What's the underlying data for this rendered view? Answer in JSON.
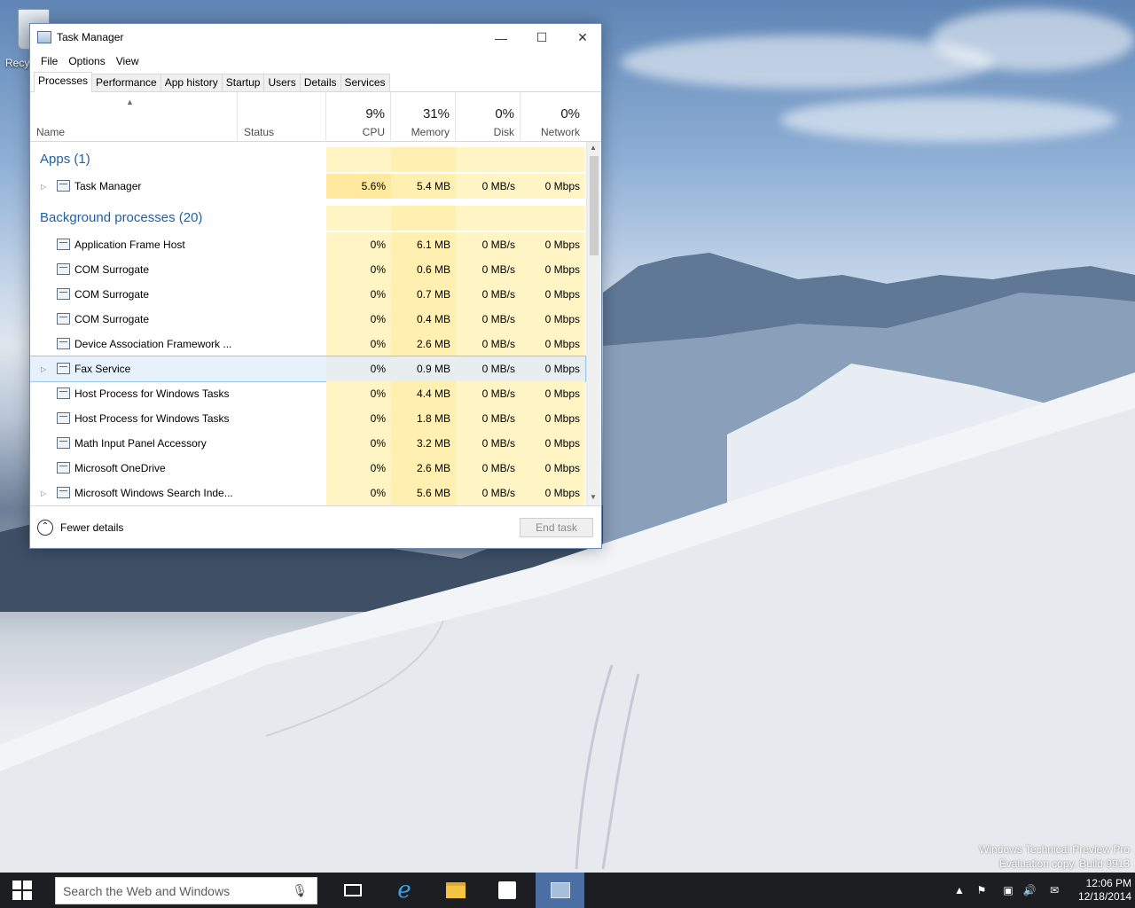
{
  "desktop": {
    "recycle_bin_label": "Recy",
    "watermark_line1": "Windows Technical Preview Pro",
    "watermark_line2": "Evaluation copy. Build 9913"
  },
  "window": {
    "title": "Task Manager",
    "menu": [
      "File",
      "Options",
      "View"
    ],
    "tabs": [
      "Processes",
      "Performance",
      "App history",
      "Startup",
      "Users",
      "Details",
      "Services"
    ],
    "active_tab": "Processes"
  },
  "columns": {
    "name": "Name",
    "status": "Status",
    "cpu": {
      "pct": "9%",
      "label": "CPU"
    },
    "memory": {
      "pct": "31%",
      "label": "Memory"
    },
    "disk": {
      "pct": "0%",
      "label": "Disk"
    },
    "network": {
      "pct": "0%",
      "label": "Network"
    }
  },
  "groups": {
    "apps": "Apps (1)",
    "background": "Background processes (20)"
  },
  "processes": [
    {
      "name": "Task Manager",
      "cpu": "5.6%",
      "mem": "5.4 MB",
      "disk": "0 MB/s",
      "net": "0 Mbps"
    },
    {
      "name": "Application Frame Host",
      "cpu": "0%",
      "mem": "6.1 MB",
      "disk": "0 MB/s",
      "net": "0 Mbps"
    },
    {
      "name": "COM Surrogate",
      "cpu": "0%",
      "mem": "0.6 MB",
      "disk": "0 MB/s",
      "net": "0 Mbps"
    },
    {
      "name": "COM Surrogate",
      "cpu": "0%",
      "mem": "0.7 MB",
      "disk": "0 MB/s",
      "net": "0 Mbps"
    },
    {
      "name": "COM Surrogate",
      "cpu": "0%",
      "mem": "0.4 MB",
      "disk": "0 MB/s",
      "net": "0 Mbps"
    },
    {
      "name": "Device Association Framework ...",
      "cpu": "0%",
      "mem": "2.6 MB",
      "disk": "0 MB/s",
      "net": "0 Mbps"
    },
    {
      "name": "Fax Service",
      "cpu": "0%",
      "mem": "0.9 MB",
      "disk": "0 MB/s",
      "net": "0 Mbps"
    },
    {
      "name": "Host Process for Windows Tasks",
      "cpu": "0%",
      "mem": "4.4 MB",
      "disk": "0 MB/s",
      "net": "0 Mbps"
    },
    {
      "name": "Host Process for Windows Tasks",
      "cpu": "0%",
      "mem": "1.8 MB",
      "disk": "0 MB/s",
      "net": "0 Mbps"
    },
    {
      "name": "Math Input Panel Accessory",
      "cpu": "0%",
      "mem": "3.2 MB",
      "disk": "0 MB/s",
      "net": "0 Mbps"
    },
    {
      "name": "Microsoft OneDrive",
      "cpu": "0%",
      "mem": "2.6 MB",
      "disk": "0 MB/s",
      "net": "0 Mbps"
    },
    {
      "name": "Microsoft Windows Search Inde...",
      "cpu": "0%",
      "mem": "5.6 MB",
      "disk": "0 MB/s",
      "net": "0 Mbps"
    }
  ],
  "footer": {
    "fewer_details": "Fewer details",
    "end_task": "End task"
  },
  "taskbar": {
    "search_placeholder": "Search the Web and Windows",
    "time": "12:06 PM",
    "date": "12/18/2014"
  }
}
